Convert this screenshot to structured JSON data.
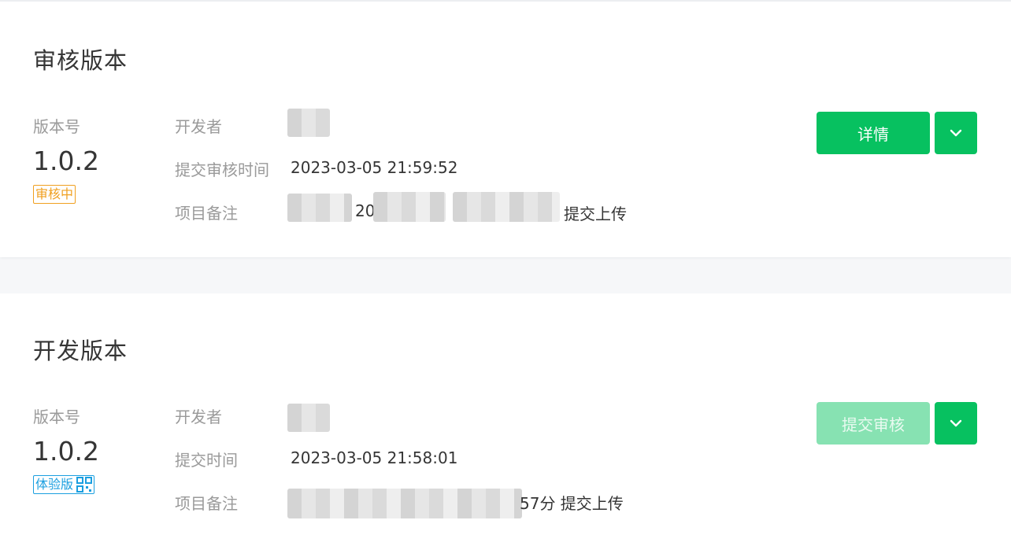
{
  "review": {
    "title": "审核版本",
    "version_label": "版本号",
    "version": "1.0.2",
    "status_badge": "审核中",
    "developer_label": "开发者",
    "submit_time_label": "提交审核时间",
    "submit_time": "2023-03-05 21:59:52",
    "remark_label": "项目备注",
    "remark_fragment_1": "20",
    "remark_suffix": "提交上传",
    "detail_button": "详情"
  },
  "dev": {
    "title": "开发版本",
    "version_label": "版本号",
    "version": "1.0.2",
    "status_badge": "体验版",
    "developer_label": "开发者",
    "submit_time_label": "提交时间",
    "submit_time": "2023-03-05 21:58:01",
    "remark_label": "项目备注",
    "remark_suffix": "57分 提交上传",
    "submit_button": "提交审核"
  },
  "colors": {
    "accent": "#07c160",
    "accent_disabled": "#87e2b2",
    "badge_reviewing": "#f0a020",
    "badge_trial": "#1b9fe0"
  }
}
